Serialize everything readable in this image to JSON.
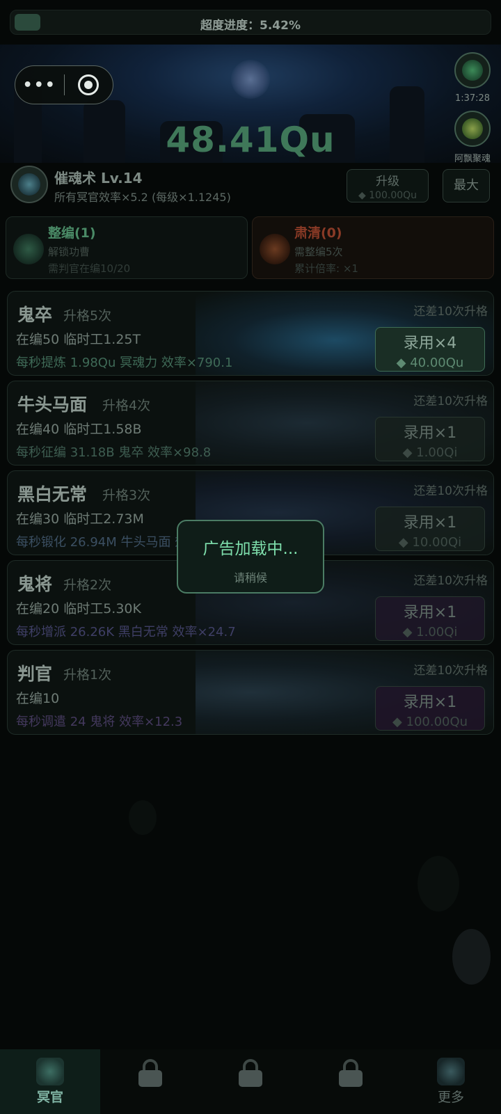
{
  "progress": {
    "label": "超度进度：5.42%",
    "value": 0.0542
  },
  "capsule": {
    "menu_icon": "•••"
  },
  "side_buttons": [
    {
      "icon": "ghost-green-icon",
      "label": "1:37:28"
    },
    {
      "icon": "mask-green-icon",
      "label": "阿飘聚魂"
    }
  ],
  "main_value": "48.41Qu",
  "skill": {
    "name": "催魂术 Lv.14",
    "desc": "所有冥官效率×5.2 (每级×1.1245)",
    "upgrade_label": "升级",
    "upgrade_cost": "◆ 100.00Qu",
    "max_label": "最大"
  },
  "panels": [
    {
      "title": "整编(1)",
      "line2": "解锁功曹",
      "line3": "需判官在编10/20",
      "color": "#4a8a66"
    },
    {
      "title": "肃清(0)",
      "line2": "需整编5次",
      "line3": "累计倍率: ×1",
      "color": "#8a3a26"
    }
  ],
  "cards": [
    {
      "name": "鬼卒",
      "promo": "升格5次",
      "remain": "还差10次升格",
      "count": "在编50  临时工1.25T",
      "rate": "每秒提炼 1.98Qu 冥魂力  效率×790.1",
      "hire": "录用×4",
      "cost": "◆ 40.00Qu",
      "active": true,
      "rate_color": "#3f6a57"
    },
    {
      "name": "牛头马面",
      "promo": "升格4次",
      "remain": "还差10次升格",
      "count": "在编40  临时工1.58B",
      "rate": "每秒征编 31.18B 鬼卒  效率×98.8",
      "hire": "录用×1",
      "cost": "◆ 1.00Qi",
      "active": false,
      "rate_color": "#3e5d51"
    },
    {
      "name": "黑白无常",
      "promo": "升格3次",
      "remain": "还差10次升格",
      "count": "在编30  临时工2.73M",
      "rate": "每秒锻化 26.94M 牛头马面  效率×49.4",
      "hire": "录用×1",
      "cost": "◆ 10.00Qi",
      "active": false,
      "rate_color": "#3b4f62"
    },
    {
      "name": "鬼将",
      "promo": "升格2次",
      "remain": "还差10次升格",
      "count": "在编20  临时工5.30K",
      "rate": "每秒增派 26.26K 黑白无常  效率×24.7",
      "hire": "录用×1",
      "cost": "◆ 1.00Qi",
      "active": false,
      "rate_color": "#3f3f66"
    },
    {
      "name": "判官",
      "promo": "升格1次",
      "remain": "还差10次升格",
      "count": "在编10",
      "rate": "每秒调遣 24 鬼将  效率×12.3",
      "hire": "录用×1",
      "cost": "◆ 100.00Qu",
      "active": false,
      "rate_color": "#44395e"
    }
  ],
  "toast": {
    "title": "广告加载中...",
    "subtitle": "请稍候"
  },
  "nav": [
    {
      "label": "冥官",
      "active": true,
      "locked": false
    },
    {
      "label": "",
      "active": false,
      "locked": true
    },
    {
      "label": "",
      "active": false,
      "locked": true
    },
    {
      "label": "",
      "active": false,
      "locked": true
    },
    {
      "label": "更多",
      "active": false,
      "locked": false
    }
  ]
}
